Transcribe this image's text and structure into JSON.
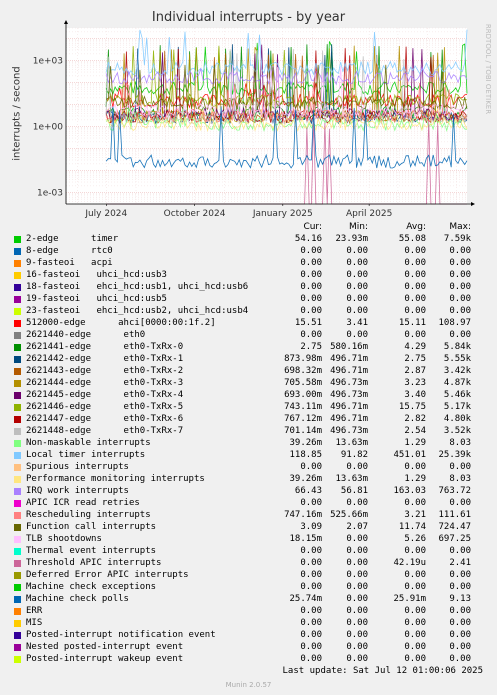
{
  "title": "Individual interrupts - by year",
  "ylabel": "interrupts / second",
  "watermark": "RRDTOOL / TOBI OETIKER",
  "columns": [
    "Cur:",
    "Min:",
    "Avg:",
    "Max:"
  ],
  "last_update": "Last update: Sat Jul 12 01:00:06 2025",
  "footer": "Munin 2.0.57",
  "chart_data": {
    "type": "line",
    "title": "Individual interrupts - by year",
    "ylabel": "interrupts / second",
    "yscale": "log",
    "ylim": [
      0.0003,
      30000
    ],
    "yticks": [
      {
        "value": 1000,
        "label": "1e+03"
      },
      {
        "value": 1,
        "label": "1e+00"
      },
      {
        "value": 0.001,
        "label": "1e-03"
      }
    ],
    "xrange": [
      "2024-05-20",
      "2025-07-12"
    ],
    "xticks": [
      {
        "label": "July 2024",
        "date": "2024-07-01"
      },
      {
        "label": "October 2024",
        "date": "2024-10-01"
      },
      {
        "label": "January 2025",
        "date": "2025-01-01"
      },
      {
        "label": "April 2025",
        "date": "2025-04-01"
      }
    ],
    "grid": true,
    "series": [
      {
        "name": "2-edge      timer",
        "color": "#00cc00",
        "cur": "54.16",
        "min": "23.93m",
        "avg": "55.08",
        "max": "7.59k"
      },
      {
        "name": "8-edge      rtc0",
        "color": "#0066b3",
        "cur": "0.00",
        "min": "0.00",
        "avg": "0.00",
        "max": "0.00"
      },
      {
        "name": "9-fasteoi   acpi",
        "color": "#ff8000",
        "cur": "0.00",
        "min": "0.00",
        "avg": "0.00",
        "max": "0.00"
      },
      {
        "name": "16-fasteoi   uhci_hcd:usb3",
        "color": "#ffcc00",
        "cur": "0.00",
        "min": "0.00",
        "avg": "0.00",
        "max": "0.00"
      },
      {
        "name": "18-fasteoi   ehci_hcd:usb1, uhci_hcd:usb6",
        "color": "#330099",
        "cur": "0.00",
        "min": "0.00",
        "avg": "0.00",
        "max": "0.00"
      },
      {
        "name": "19-fasteoi   uhci_hcd:usb5",
        "color": "#990099",
        "cur": "0.00",
        "min": "0.00",
        "avg": "0.00",
        "max": "0.00"
      },
      {
        "name": "23-fasteoi   ehci_hcd:usb2, uhci_hcd:usb4",
        "color": "#ccff00",
        "cur": "0.00",
        "min": "0.00",
        "avg": "0.00",
        "max": "0.00"
      },
      {
        "name": "512000-edge      ahci[0000:00:1f.2]",
        "color": "#ff0000",
        "cur": "15.51",
        "min": "3.41",
        "avg": "15.11",
        "max": "108.97"
      },
      {
        "name": "2621440-edge      eth0",
        "color": "#808080",
        "cur": "0.00",
        "min": "0.00",
        "avg": "0.00",
        "max": "0.00"
      },
      {
        "name": "2621441-edge      eth0-TxRx-0",
        "color": "#008f00",
        "cur": "2.75",
        "min": "580.16m",
        "avg": "4.29",
        "max": "5.84k"
      },
      {
        "name": "2621442-edge      eth0-TxRx-1",
        "color": "#00487d",
        "cur": "873.98m",
        "min": "496.71m",
        "avg": "2.75",
        "max": "5.55k"
      },
      {
        "name": "2621443-edge      eth0-TxRx-2",
        "color": "#b35a00",
        "cur": "698.32m",
        "min": "496.71m",
        "avg": "2.87",
        "max": "3.42k"
      },
      {
        "name": "2621444-edge      eth0-TxRx-3",
        "color": "#b38f00",
        "cur": "705.58m",
        "min": "496.73m",
        "avg": "3.23",
        "max": "4.87k"
      },
      {
        "name": "2621445-edge      eth0-TxRx-4",
        "color": "#6b006b",
        "cur": "693.00m",
        "min": "496.73m",
        "avg": "3.40",
        "max": "5.46k"
      },
      {
        "name": "2621446-edge      eth0-TxRx-5",
        "color": "#8fb300",
        "cur": "743.11m",
        "min": "496.71m",
        "avg": "15.75",
        "max": "5.17k"
      },
      {
        "name": "2621447-edge      eth0-TxRx-6",
        "color": "#b30000",
        "cur": "767.12m",
        "min": "496.71m",
        "avg": "2.82",
        "max": "4.80k"
      },
      {
        "name": "2621448-edge      eth0-TxRx-7",
        "color": "#bebebe",
        "cur": "701.14m",
        "min": "496.73m",
        "avg": "2.54",
        "max": "3.52k"
      },
      {
        "name": "Non-maskable interrupts",
        "color": "#80ff80",
        "cur": "39.26m",
        "min": "13.63m",
        "avg": "1.29",
        "max": "8.03"
      },
      {
        "name": "Local timer interrupts",
        "color": "#80c9ff",
        "cur": "118.85",
        "min": "91.82",
        "avg": "451.01",
        "max": "25.39k"
      },
      {
        "name": "Spurious interrupts",
        "color": "#ffc080",
        "cur": "0.00",
        "min": "0.00",
        "avg": "0.00",
        "max": "0.00"
      },
      {
        "name": "Performance monitoring interrupts",
        "color": "#ffe680",
        "cur": "39.26m",
        "min": "13.63m",
        "avg": "1.29",
        "max": "8.03"
      },
      {
        "name": "IRQ work interrupts",
        "color": "#aa80ff",
        "cur": "66.43",
        "min": "56.81",
        "avg": "163.03",
        "max": "763.72"
      },
      {
        "name": "APIC ICR read retries",
        "color": "#ee00cc",
        "cur": "0.00",
        "min": "0.00",
        "avg": "0.00",
        "max": "0.00"
      },
      {
        "name": "Rescheduling interrupts",
        "color": "#ff8080",
        "cur": "747.16m",
        "min": "525.66m",
        "avg": "3.21",
        "max": "111.61"
      },
      {
        "name": "Function call interrupts",
        "color": "#666600",
        "cur": "3.09",
        "min": "2.07",
        "avg": "11.74",
        "max": "724.47"
      },
      {
        "name": "TLB shootdowns",
        "color": "#ffbfff",
        "cur": "18.15m",
        "min": "0.00",
        "avg": "5.26",
        "max": "697.25"
      },
      {
        "name": "Thermal event interrupts",
        "color": "#00ffcc",
        "cur": "0.00",
        "min": "0.00",
        "avg": "0.00",
        "max": "0.00"
      },
      {
        "name": "Threshold APIC interrupts",
        "color": "#cc6699",
        "cur": "0.00",
        "min": "0.00",
        "avg": "42.19u",
        "max": "2.41"
      },
      {
        "name": "Deferred Error APIC interrupts",
        "color": "#999900",
        "cur": "0.00",
        "min": "0.00",
        "avg": "0.00",
        "max": "0.00"
      },
      {
        "name": "Machine check exceptions",
        "color": "#00cc00",
        "cur": "0.00",
        "min": "0.00",
        "avg": "0.00",
        "max": "0.00"
      },
      {
        "name": "Machine check polls",
        "color": "#0066b3",
        "cur": "25.74m",
        "min": "0.00",
        "avg": "25.91m",
        "max": "9.13"
      },
      {
        "name": "ERR",
        "color": "#ff8000",
        "cur": "0.00",
        "min": "0.00",
        "avg": "0.00",
        "max": "0.00"
      },
      {
        "name": "MIS",
        "color": "#ffcc00",
        "cur": "0.00",
        "min": "0.00",
        "avg": "0.00",
        "max": "0.00"
      },
      {
        "name": "Posted-interrupt notification event",
        "color": "#330099",
        "cur": "0.00",
        "min": "0.00",
        "avg": "0.00",
        "max": "0.00"
      },
      {
        "name": "Nested posted-interrupt event",
        "color": "#990099",
        "cur": "0.00",
        "min": "0.00",
        "avg": "0.00",
        "max": "0.00"
      },
      {
        "name": "Posted-interrupt wakeup event",
        "color": "#ccff00",
        "cur": "0.00",
        "min": "0.00",
        "avg": "0.00",
        "max": "0.00"
      }
    ]
  }
}
